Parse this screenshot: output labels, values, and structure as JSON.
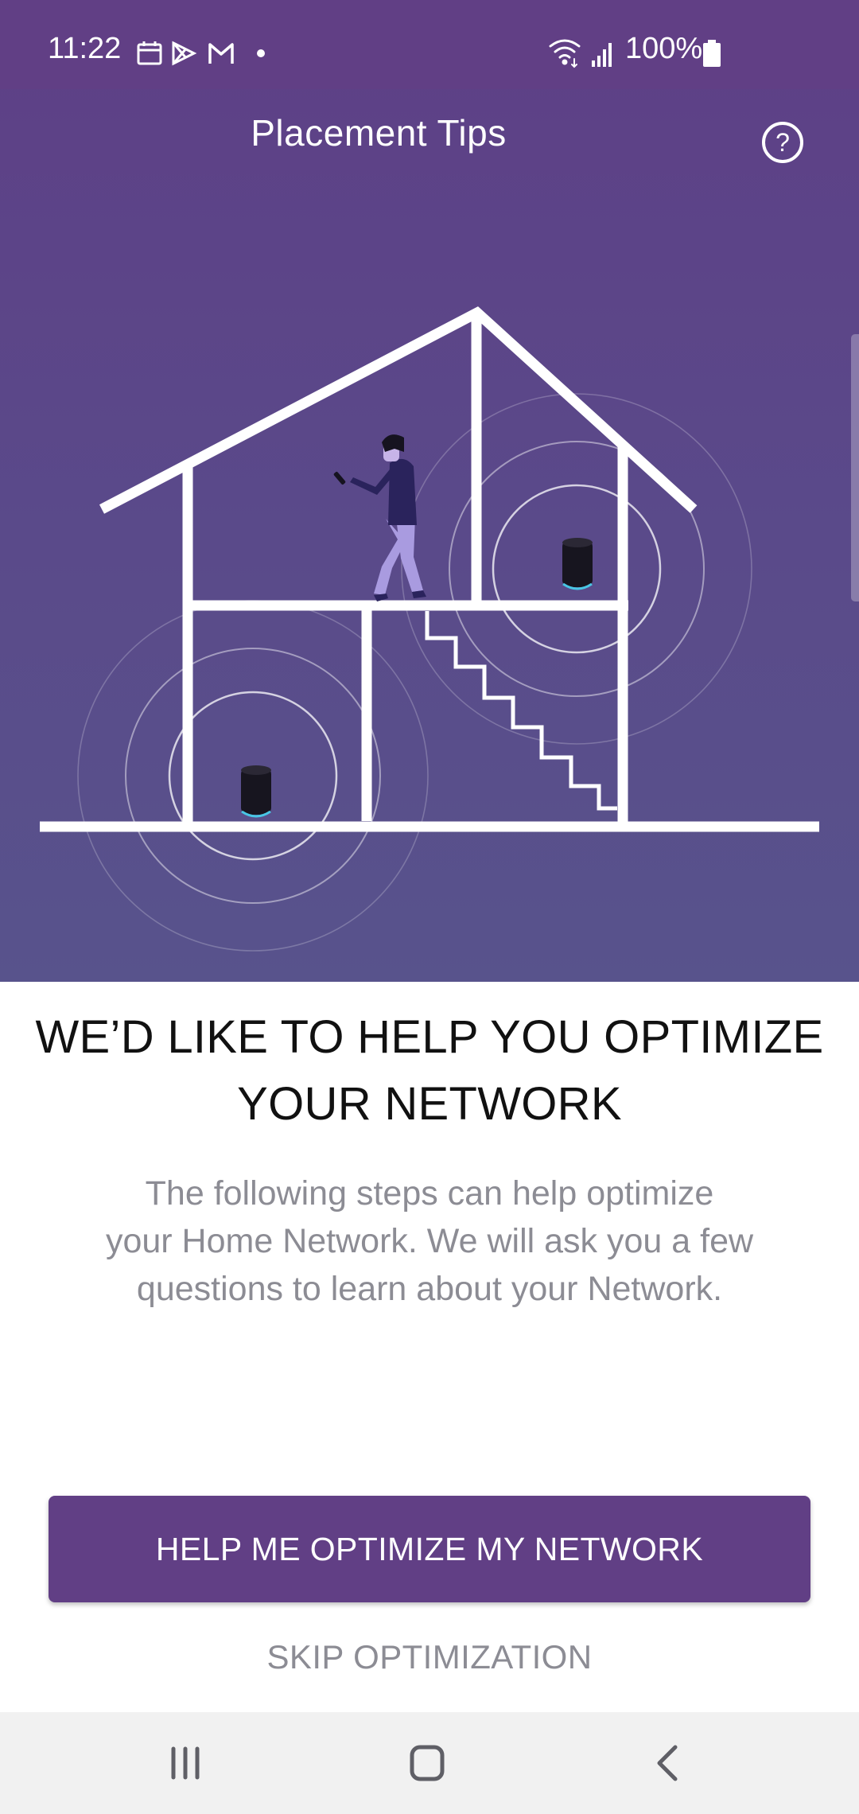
{
  "status_bar": {
    "time": "11:22",
    "battery": "100%",
    "left_icons": [
      "calendar-icon",
      "play-store-icon",
      "gmail-icon",
      "dot-icon"
    ],
    "right_icons": [
      "wifi-icon",
      "signal-icon",
      "battery-icon"
    ]
  },
  "app_bar": {
    "title": "Placement Tips",
    "help_icon": "help-circle-icon"
  },
  "main": {
    "headline_line1": "WE’D LIKE TO HELP YOU OPTIMIZE",
    "headline_line2": "YOUR NETWORK",
    "body_line1": "The following steps can help optimize",
    "body_line2": "your Home Network. We will ask you a few",
    "body_line3": "questions to learn about your Network.",
    "primary_button": "HELP ME OPTIMIZE MY NETWORK",
    "secondary_button": "SKIP OPTIMIZATION"
  },
  "nav_bar": {
    "icons": [
      "recent-apps-icon",
      "home-icon",
      "back-icon"
    ]
  },
  "colors": {
    "brand": "#613f85",
    "hero_bottom": "#58538c",
    "body_text": "#8c8c94",
    "person_shirt": "#2a235c",
    "person_pants": "#a99be0",
    "router_light": "#49c6e5"
  }
}
